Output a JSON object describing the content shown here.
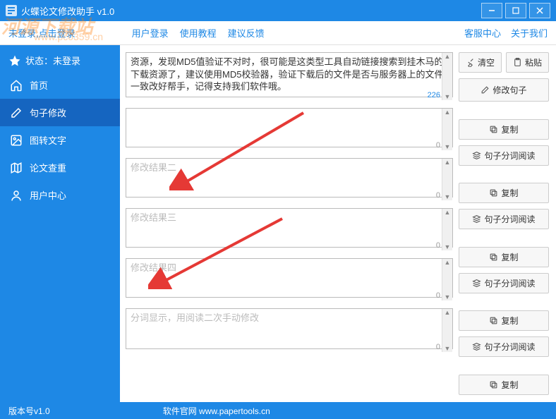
{
  "titlebar": {
    "title": "火蝶论文修改助手 v1.0"
  },
  "topbar": {
    "login_hint": "未登录,点击登录",
    "nav": {
      "user_login": "用户登录",
      "tutorial": "使用教程",
      "feedback": "建议反馈"
    },
    "right": {
      "service": "客服中心",
      "about": "关于我们"
    }
  },
  "sidebar": {
    "status_label": "状态：未登录",
    "items": [
      {
        "label": "首页"
      },
      {
        "label": "句子修改"
      },
      {
        "label": "图转文字"
      },
      {
        "label": "论文查重"
      },
      {
        "label": "用户中心"
      }
    ]
  },
  "content": {
    "main_text": "资源，发现MD5值验证不对时，很可能是这类型工具自动链接搜索到挂木马的下载资源了，建议使用MD5校验器，验证下载后的文件是否与服务器上的文件一致改好帮手，记得支持我们软件哦。",
    "main_count": "226",
    "results": [
      {
        "placeholder": "",
        "count": "0"
      },
      {
        "placeholder": "修改结果二",
        "count": "0"
      },
      {
        "placeholder": "修改结果三",
        "count": "0"
      },
      {
        "placeholder": "修改结果四",
        "count": "0"
      }
    ],
    "segment": {
      "placeholder": "分词显示，用阅读二次手动修改",
      "count": "0"
    }
  },
  "actions": {
    "clear": "清空",
    "paste": "粘贴",
    "modify": "修改句子",
    "copy": "复制",
    "read": "句子分词阅读"
  },
  "footer": {
    "version": "版本号v1.0",
    "site": "软件官网 www.papertools.cn"
  },
  "watermark": {
    "line1": "河源下载站",
    "line2": "www.pc0359.cn"
  }
}
